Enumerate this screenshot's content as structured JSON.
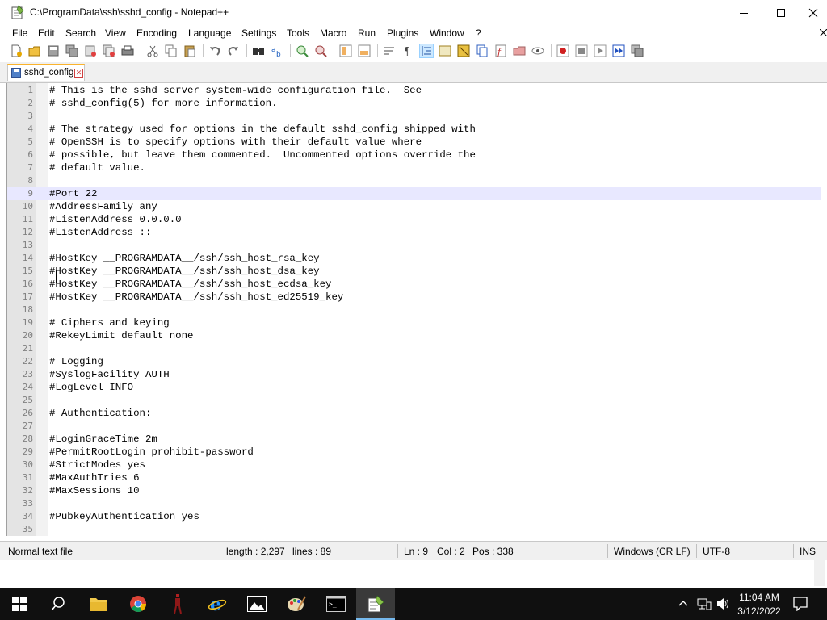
{
  "window": {
    "title": "C:\\ProgramData\\ssh\\sshd_config - Notepad++"
  },
  "menu": [
    "File",
    "Edit",
    "Search",
    "View",
    "Encoding",
    "Language",
    "Settings",
    "Tools",
    "Macro",
    "Run",
    "Plugins",
    "Window",
    "?"
  ],
  "toolbar": {
    "icons": [
      "new-file-icon",
      "open-file-icon",
      "save-icon",
      "save-all-icon",
      "close-icon",
      "close-all-icon",
      "print-icon",
      "cut-icon",
      "copy-icon",
      "paste-icon",
      "undo-icon",
      "redo-icon",
      "find-icon",
      "replace-icon",
      "zoom-in-icon",
      "zoom-out-icon",
      "sync-vertical-icon",
      "sync-horizontal-icon",
      "word-wrap-icon",
      "show-all-chars-icon",
      "indent-guide-icon",
      "user-language-icon",
      "doc-map-icon",
      "doc-list-icon",
      "function-list-icon",
      "folder-workspace-icon",
      "monitoring-icon",
      "record-macro-icon",
      "stop-macro-icon",
      "play-macro-icon",
      "run-macro-multiple-icon",
      "save-macro-icon"
    ]
  },
  "tab": {
    "label": "sshd_config"
  },
  "editor": {
    "current_line": 9,
    "lines": [
      {
        "n": "1",
        "text": "# This is the sshd server system-wide configuration file.  See"
      },
      {
        "n": "2",
        "text": "# sshd_config(5) for more information."
      },
      {
        "n": "3",
        "text": ""
      },
      {
        "n": "4",
        "text": "# The strategy used for options in the default sshd_config shipped with"
      },
      {
        "n": "5",
        "text": "# OpenSSH is to specify options with their default value where"
      },
      {
        "n": "6",
        "text": "# possible, but leave them commented.  Uncommented options override the"
      },
      {
        "n": "7",
        "text": "# default value."
      },
      {
        "n": "8",
        "text": ""
      },
      {
        "n": "9",
        "text": "#Port 22"
      },
      {
        "n": "10",
        "text": "#AddressFamily any"
      },
      {
        "n": "11",
        "text": "#ListenAddress 0.0.0.0"
      },
      {
        "n": "12",
        "text": "#ListenAddress ::"
      },
      {
        "n": "13",
        "text": ""
      },
      {
        "n": "14",
        "text": "#HostKey __PROGRAMDATA__/ssh/ssh_host_rsa_key"
      },
      {
        "n": "15",
        "text": "#HostKey __PROGRAMDATA__/ssh/ssh_host_dsa_key"
      },
      {
        "n": "16",
        "text": "#HostKey __PROGRAMDATA__/ssh/ssh_host_ecdsa_key"
      },
      {
        "n": "17",
        "text": "#HostKey __PROGRAMDATA__/ssh/ssh_host_ed25519_key"
      },
      {
        "n": "18",
        "text": ""
      },
      {
        "n": "19",
        "text": "# Ciphers and keying"
      },
      {
        "n": "20",
        "text": "#RekeyLimit default none"
      },
      {
        "n": "21",
        "text": ""
      },
      {
        "n": "22",
        "text": "# Logging"
      },
      {
        "n": "23",
        "text": "#SyslogFacility AUTH"
      },
      {
        "n": "24",
        "text": "#LogLevel INFO"
      },
      {
        "n": "25",
        "text": ""
      },
      {
        "n": "26",
        "text": "# Authentication:"
      },
      {
        "n": "27",
        "text": ""
      },
      {
        "n": "28",
        "text": "#LoginGraceTime 2m"
      },
      {
        "n": "29",
        "text": "#PermitRootLogin prohibit-password"
      },
      {
        "n": "30",
        "text": "#StrictModes yes"
      },
      {
        "n": "31",
        "text": "#MaxAuthTries 6"
      },
      {
        "n": "32",
        "text": "#MaxSessions 10"
      },
      {
        "n": "33",
        "text": ""
      },
      {
        "n": "34",
        "text": "#PubkeyAuthentication yes"
      },
      {
        "n": "35",
        "text": ""
      }
    ]
  },
  "status": {
    "file_type": "Normal text file",
    "length": "length : 2,297",
    "lines": "lines : 89",
    "ln": "Ln : 9",
    "col": "Col : 2",
    "pos": "Pos : 338",
    "eol": "Windows (CR LF)",
    "encoding": "UTF-8",
    "mode": "INS"
  },
  "taskbar": {
    "apps": [
      "start-icon",
      "search-icon",
      "file-explorer-icon",
      "chrome-icon",
      "app-figure-icon",
      "internet-explorer-icon",
      "photos-icon",
      "paint-icon",
      "terminal-icon",
      "notepadpp-icon"
    ],
    "time": "11:04 AM",
    "date": "3/12/2022"
  },
  "colors": {
    "current_line_bg": "#e8e8ff",
    "tab_accent": "#fab32d",
    "taskbar_bg": "#101010",
    "active_indicator": "#76b9ed"
  }
}
